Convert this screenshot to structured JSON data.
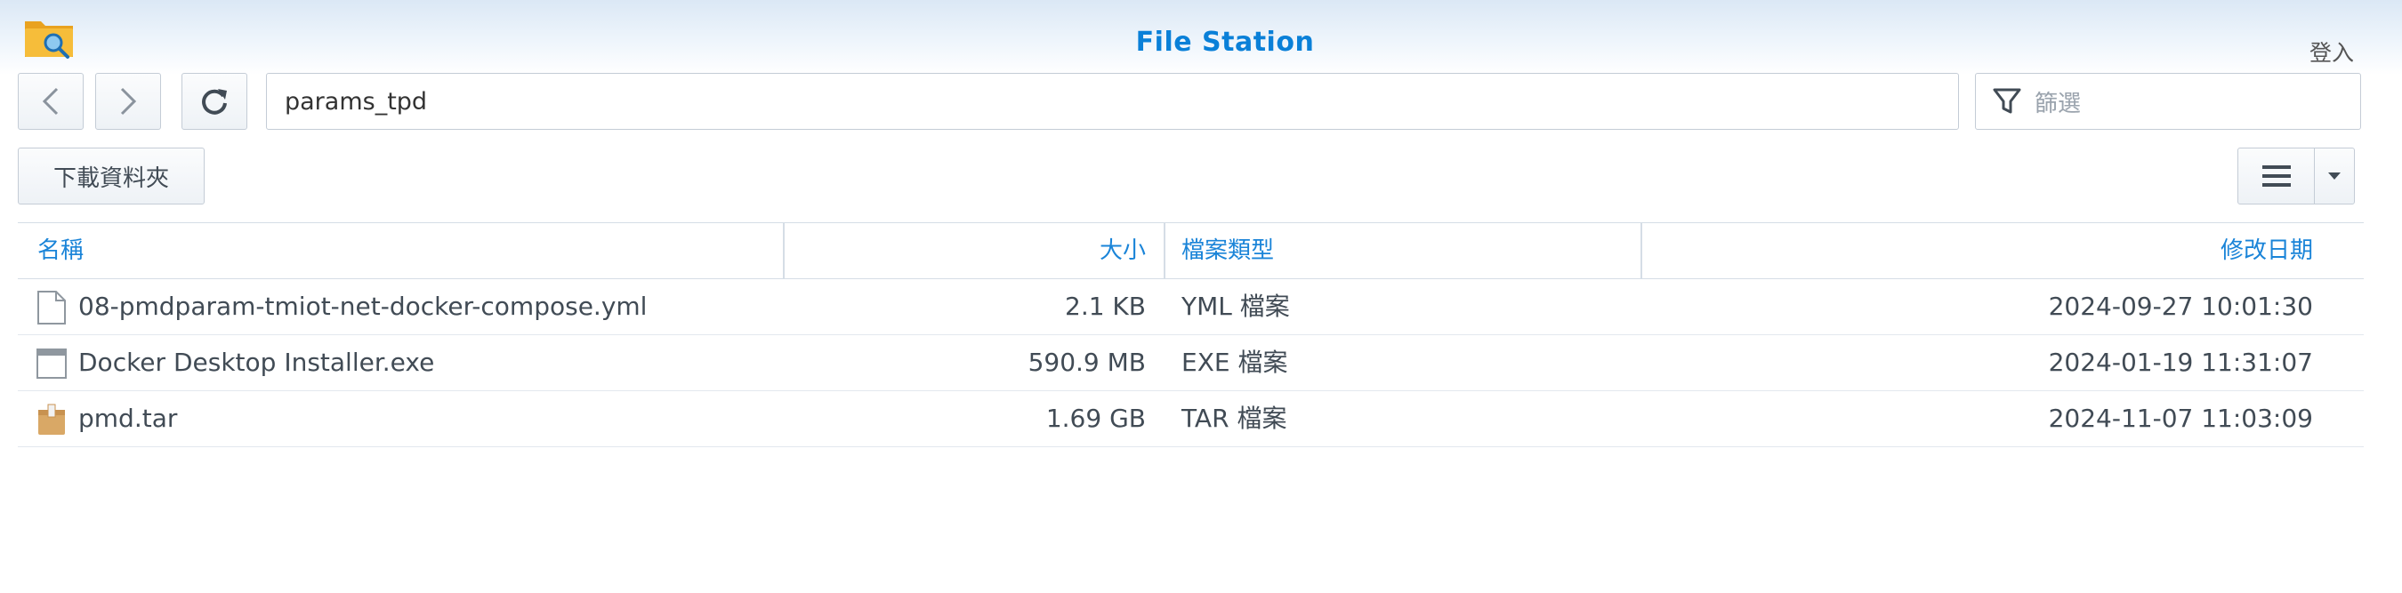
{
  "app": {
    "title": "File Station",
    "login": "登入"
  },
  "toolbar": {
    "path": "params_tpd",
    "filter_placeholder": "篩選",
    "download_folder": "下載資料夾"
  },
  "table": {
    "columns": {
      "name": "名稱",
      "size": "大小",
      "type": "檔案類型",
      "modified": "修改日期"
    },
    "rows": [
      {
        "icon": "document-icon",
        "name": "08-pmdparam-tmiot-net-docker-compose.yml",
        "size": "2.1 KB",
        "type": "YML 檔案",
        "modified": "2024-09-27 10:01:30"
      },
      {
        "icon": "executable-window-icon",
        "name": "Docker Desktop Installer.exe",
        "size": "590.9 MB",
        "type": "EXE 檔案",
        "modified": "2024-01-19 11:31:07"
      },
      {
        "icon": "archive-box-icon",
        "name": "pmd.tar",
        "size": "1.69 GB",
        "type": "TAR 檔案",
        "modified": "2024-11-07 11:03:09"
      }
    ]
  },
  "colors": {
    "accent": "#0a80d8",
    "header_text": "#1a84d8",
    "text": "#414b55"
  }
}
